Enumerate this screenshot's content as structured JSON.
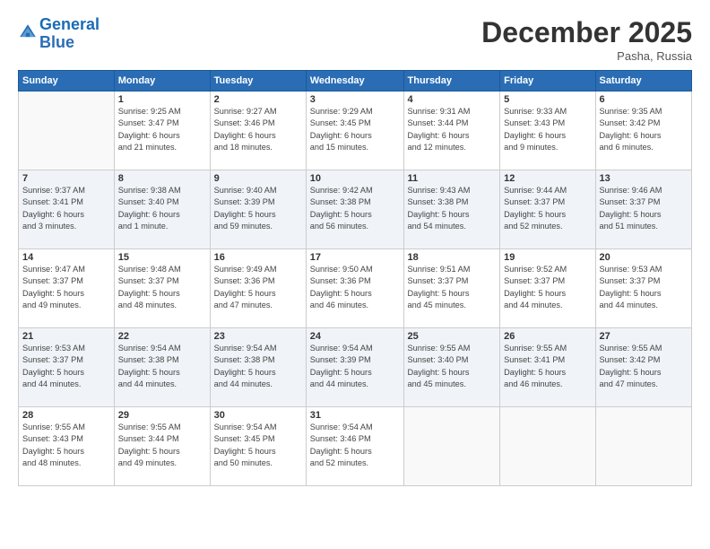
{
  "logo": {
    "line1": "General",
    "line2": "Blue"
  },
  "title": "December 2025",
  "location": "Pasha, Russia",
  "days_header": [
    "Sunday",
    "Monday",
    "Tuesday",
    "Wednesday",
    "Thursday",
    "Friday",
    "Saturday"
  ],
  "weeks": [
    [
      {
        "num": "",
        "info": ""
      },
      {
        "num": "1",
        "info": "Sunrise: 9:25 AM\nSunset: 3:47 PM\nDaylight: 6 hours\nand 21 minutes."
      },
      {
        "num": "2",
        "info": "Sunrise: 9:27 AM\nSunset: 3:46 PM\nDaylight: 6 hours\nand 18 minutes."
      },
      {
        "num": "3",
        "info": "Sunrise: 9:29 AM\nSunset: 3:45 PM\nDaylight: 6 hours\nand 15 minutes."
      },
      {
        "num": "4",
        "info": "Sunrise: 9:31 AM\nSunset: 3:44 PM\nDaylight: 6 hours\nand 12 minutes."
      },
      {
        "num": "5",
        "info": "Sunrise: 9:33 AM\nSunset: 3:43 PM\nDaylight: 6 hours\nand 9 minutes."
      },
      {
        "num": "6",
        "info": "Sunrise: 9:35 AM\nSunset: 3:42 PM\nDaylight: 6 hours\nand 6 minutes."
      }
    ],
    [
      {
        "num": "7",
        "info": "Sunrise: 9:37 AM\nSunset: 3:41 PM\nDaylight: 6 hours\nand 3 minutes."
      },
      {
        "num": "8",
        "info": "Sunrise: 9:38 AM\nSunset: 3:40 PM\nDaylight: 6 hours\nand 1 minute."
      },
      {
        "num": "9",
        "info": "Sunrise: 9:40 AM\nSunset: 3:39 PM\nDaylight: 5 hours\nand 59 minutes."
      },
      {
        "num": "10",
        "info": "Sunrise: 9:42 AM\nSunset: 3:38 PM\nDaylight: 5 hours\nand 56 minutes."
      },
      {
        "num": "11",
        "info": "Sunrise: 9:43 AM\nSunset: 3:38 PM\nDaylight: 5 hours\nand 54 minutes."
      },
      {
        "num": "12",
        "info": "Sunrise: 9:44 AM\nSunset: 3:37 PM\nDaylight: 5 hours\nand 52 minutes."
      },
      {
        "num": "13",
        "info": "Sunrise: 9:46 AM\nSunset: 3:37 PM\nDaylight: 5 hours\nand 51 minutes."
      }
    ],
    [
      {
        "num": "14",
        "info": "Sunrise: 9:47 AM\nSunset: 3:37 PM\nDaylight: 5 hours\nand 49 minutes."
      },
      {
        "num": "15",
        "info": "Sunrise: 9:48 AM\nSunset: 3:37 PM\nDaylight: 5 hours\nand 48 minutes."
      },
      {
        "num": "16",
        "info": "Sunrise: 9:49 AM\nSunset: 3:36 PM\nDaylight: 5 hours\nand 47 minutes."
      },
      {
        "num": "17",
        "info": "Sunrise: 9:50 AM\nSunset: 3:36 PM\nDaylight: 5 hours\nand 46 minutes."
      },
      {
        "num": "18",
        "info": "Sunrise: 9:51 AM\nSunset: 3:37 PM\nDaylight: 5 hours\nand 45 minutes."
      },
      {
        "num": "19",
        "info": "Sunrise: 9:52 AM\nSunset: 3:37 PM\nDaylight: 5 hours\nand 44 minutes."
      },
      {
        "num": "20",
        "info": "Sunrise: 9:53 AM\nSunset: 3:37 PM\nDaylight: 5 hours\nand 44 minutes."
      }
    ],
    [
      {
        "num": "21",
        "info": "Sunrise: 9:53 AM\nSunset: 3:37 PM\nDaylight: 5 hours\nand 44 minutes."
      },
      {
        "num": "22",
        "info": "Sunrise: 9:54 AM\nSunset: 3:38 PM\nDaylight: 5 hours\nand 44 minutes."
      },
      {
        "num": "23",
        "info": "Sunrise: 9:54 AM\nSunset: 3:38 PM\nDaylight: 5 hours\nand 44 minutes."
      },
      {
        "num": "24",
        "info": "Sunrise: 9:54 AM\nSunset: 3:39 PM\nDaylight: 5 hours\nand 44 minutes."
      },
      {
        "num": "25",
        "info": "Sunrise: 9:55 AM\nSunset: 3:40 PM\nDaylight: 5 hours\nand 45 minutes."
      },
      {
        "num": "26",
        "info": "Sunrise: 9:55 AM\nSunset: 3:41 PM\nDaylight: 5 hours\nand 46 minutes."
      },
      {
        "num": "27",
        "info": "Sunrise: 9:55 AM\nSunset: 3:42 PM\nDaylight: 5 hours\nand 47 minutes."
      }
    ],
    [
      {
        "num": "28",
        "info": "Sunrise: 9:55 AM\nSunset: 3:43 PM\nDaylight: 5 hours\nand 48 minutes."
      },
      {
        "num": "29",
        "info": "Sunrise: 9:55 AM\nSunset: 3:44 PM\nDaylight: 5 hours\nand 49 minutes."
      },
      {
        "num": "30",
        "info": "Sunrise: 9:54 AM\nSunset: 3:45 PM\nDaylight: 5 hours\nand 50 minutes."
      },
      {
        "num": "31",
        "info": "Sunrise: 9:54 AM\nSunset: 3:46 PM\nDaylight: 5 hours\nand 52 minutes."
      },
      {
        "num": "",
        "info": ""
      },
      {
        "num": "",
        "info": ""
      },
      {
        "num": "",
        "info": ""
      }
    ]
  ]
}
